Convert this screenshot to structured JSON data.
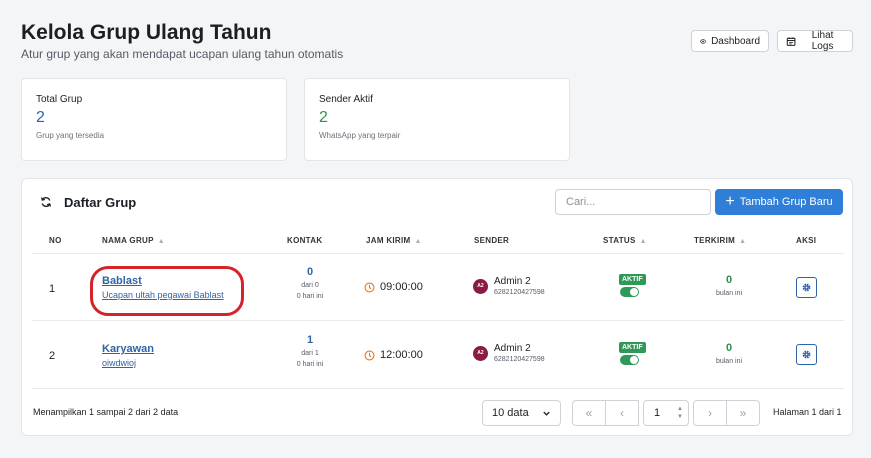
{
  "header": {
    "title": "Kelola Grup Ulang Tahun",
    "subtitle": "Atur grup yang akan mendapat ucapan ulang tahun otomatis",
    "dashboard_label": "Dashboard",
    "logs_label": "Lihat Logs"
  },
  "stats": {
    "total": {
      "label": "Total Grup",
      "value": "2",
      "hint": "Grup yang tersedia"
    },
    "sender": {
      "label": "Sender Aktif",
      "value": "2",
      "hint": "WhatsApp yang terpair"
    }
  },
  "panel": {
    "title": "Daftar Grup",
    "search_placeholder": "Cari...",
    "add_label": "Tambah Grup Baru"
  },
  "columns": {
    "no": "NO",
    "nama": "NAMA GRUP",
    "kontak": "KONTAK",
    "jam": "JAM KIRIM",
    "sender": "SENDER",
    "status": "STATUS",
    "terkirim": "TERKIRIM",
    "aksi": "AKSI"
  },
  "rows": [
    {
      "no": "1",
      "name": "Bablast",
      "desc": "Ucapan ultah pegawai Bablast",
      "kontak": "0",
      "kontak_of": "dari 0",
      "kontak_days": "0 hari ini",
      "jam": "09:00:00",
      "avatar": "A2",
      "sender_name": "Admin 2",
      "sender_phone": "6282120427598",
      "status": "AKTIF",
      "terkirim": "0",
      "terkirim_sub": "bulan ini"
    },
    {
      "no": "2",
      "name": "Karyawan",
      "desc": "oiwdwioj",
      "kontak": "1",
      "kontak_of": "dari 1",
      "kontak_days": "0 hari ini",
      "jam": "12:00:00",
      "avatar": "A2",
      "sender_name": "Admin 2",
      "sender_phone": "6282120427598",
      "status": "AKTIF",
      "terkirim": "0",
      "terkirim_sub": "bulan ini"
    }
  ],
  "footer": {
    "showing": "Menampilkan 1 sampai 2 dari 2 data",
    "per_page": "10 data",
    "page_value": "1",
    "page_info": "Halaman 1 dari 1"
  },
  "colors": {
    "primary": "#2f7fd8",
    "link": "#2f64a7",
    "success": "#2f9a57",
    "highlight": "#d8222a"
  }
}
